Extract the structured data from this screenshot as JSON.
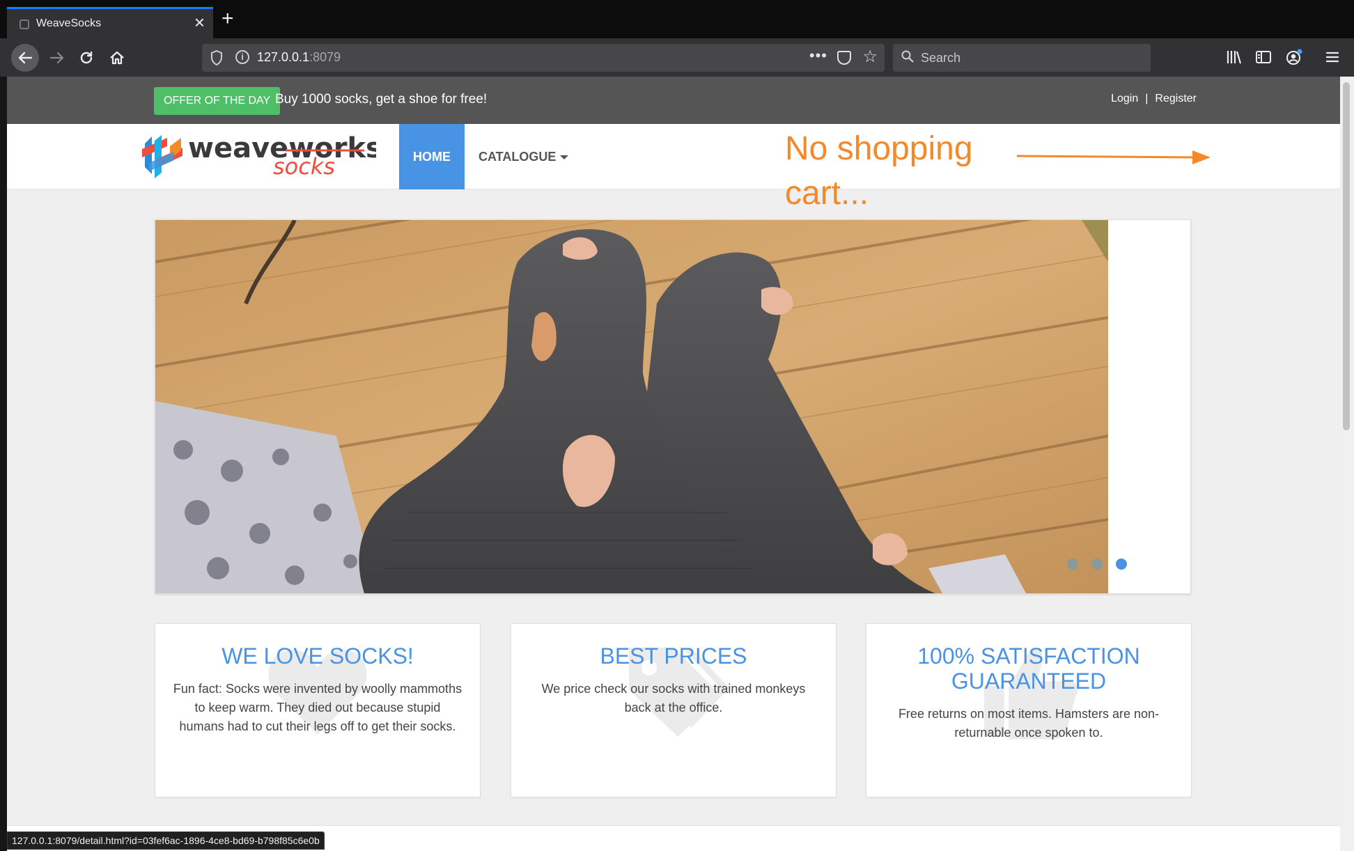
{
  "browser": {
    "tab_title": "WeaveSocks",
    "url_host": "127.0.0.1",
    "url_port": ":8079",
    "search_placeholder": "Search",
    "status_url": "127.0.0.1:8079/detail.html?id=03fef6ac-1896-4ce8-bd69-b798f85c6e0b",
    "accent_color": "#0a84ff"
  },
  "topbar": {
    "offer_badge": "OFFER OF THE DAY",
    "offer_text": "Buy 1000 socks, get a shoe for free!",
    "login": "Login",
    "separator": "|",
    "register": "Register",
    "offer_color": "#4fbf67"
  },
  "nav": {
    "logo_word1": "weaveworks",
    "logo_word2": "socks",
    "home": "HOME",
    "catalogue": "CATALOGUE",
    "active_color": "#4993e4"
  },
  "annotation": {
    "line1": "No shopping",
    "line2": "cart...",
    "color": "#f4892a"
  },
  "carousel": {
    "slide_count": 3,
    "active_index": 2
  },
  "features": [
    {
      "title": "WE LOVE SOCKS!",
      "text": "Fun fact: Socks were invented by woolly mammoths to keep warm. They died out because stupid humans had to cut their legs off to get their socks.",
      "icon": "heart-icon"
    },
    {
      "title": "BEST PRICES",
      "text": "We price check our socks with trained monkeys back at the office.",
      "icon": "tags-icon"
    },
    {
      "title": "100% SATISFACTION GUARANTEED",
      "text": "Free returns on most items. Hamsters are non-returnable once spoken to.",
      "icon": "thumbs-up-icon"
    }
  ]
}
